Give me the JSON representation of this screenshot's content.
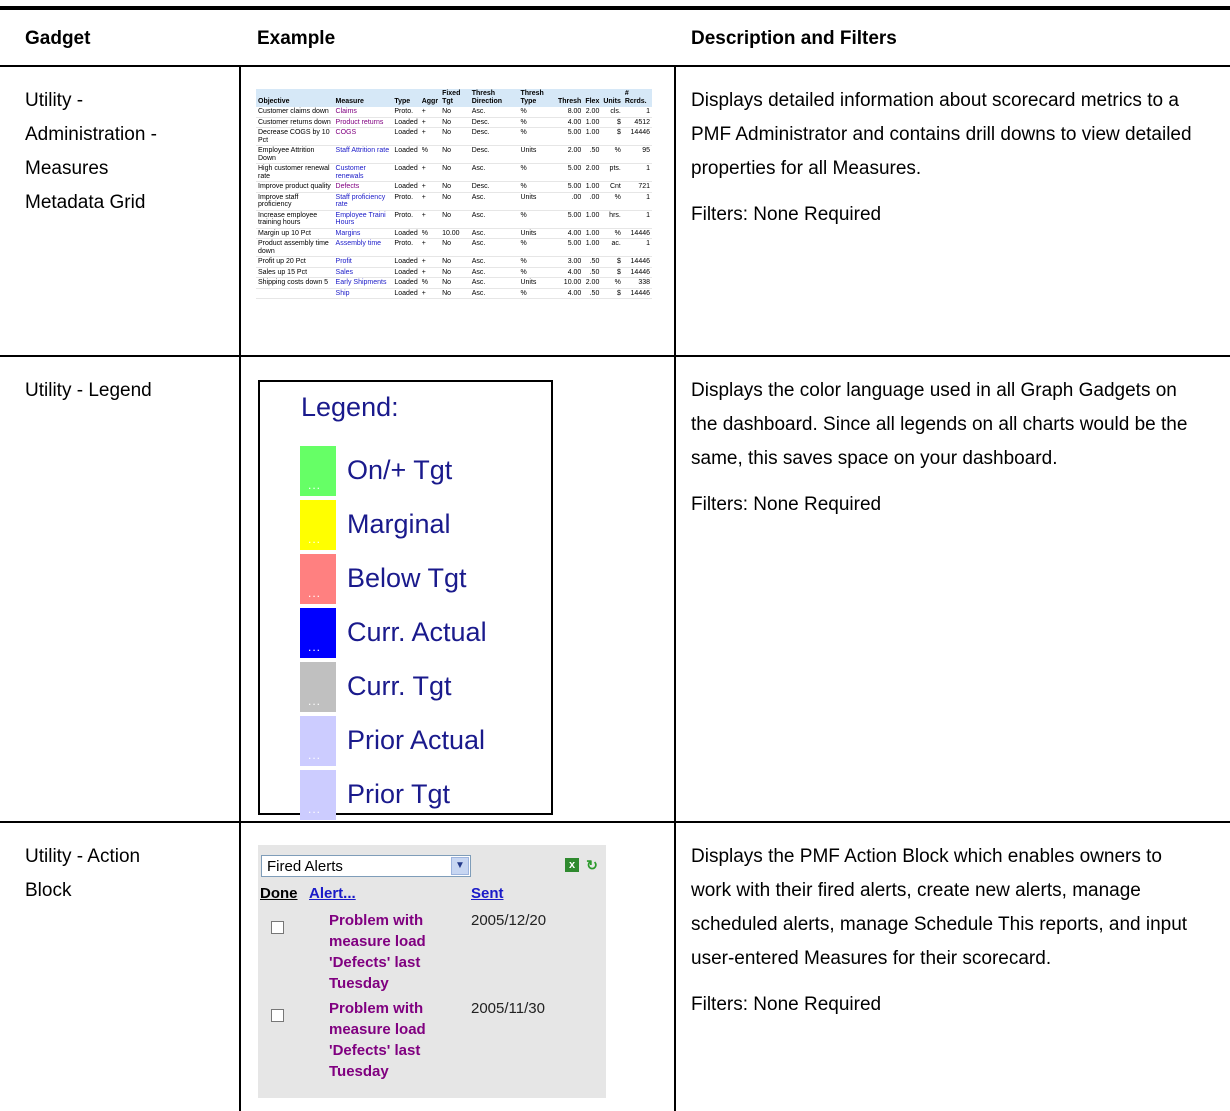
{
  "headers": {
    "gadget": "Gadget",
    "example": "Example",
    "description": "Description and Filters"
  },
  "rows": [
    {
      "gadget_lines": [
        "Utility -",
        "Administration -",
        "Measures",
        "Metadata Grid"
      ],
      "description": "Displays detailed information about scorecard metrics to a PMF Administrator and contains drill downs to view detailed properties for all Measures.",
      "filters": "Filters: None Required"
    },
    {
      "gadget_lines": [
        "Utility - Legend"
      ],
      "description": "Displays the color language used in all Graph Gadgets on the dashboard. Since all legends on all charts would be the same, this saves space on your dashboard.",
      "filters": "Filters: None Required"
    },
    {
      "gadget_lines": [
        "Utility - Action",
        "Block"
      ],
      "description": "Displays the PMF Action Block which enables owners to work with their fired alerts, create new alerts, manage scheduled alerts, manage Schedule This reports, and input user-entered Measures for their scorecard.",
      "filters": "Filters: None Required"
    }
  ],
  "metadata_grid": {
    "columns": [
      "Objective",
      "Measure",
      "Type",
      "Aggr",
      "Fixed Tgt",
      "Thresh Direction",
      "Thresh Type",
      "Thresh",
      "Flex",
      "Units",
      "# Rcrds."
    ],
    "rows": [
      [
        "Customer claims down",
        "Claims",
        "Proto.",
        "+",
        "No",
        "Asc.",
        "%",
        "8.00",
        "2.00",
        "cls.",
        "1"
      ],
      [
        "Customer returns down",
        "Product returns",
        "Loaded",
        "+",
        "No",
        "Desc.",
        "%",
        "4.00",
        "1.00",
        "$",
        "4512"
      ],
      [
        "Decrease COGS by 10 Pct",
        "COGS",
        "Loaded",
        "+",
        "No",
        "Desc.",
        "%",
        "5.00",
        "1.00",
        "$",
        "14446"
      ],
      [
        "Employee Attrition Down",
        "Staff Attrition rate",
        "Loaded",
        "%",
        "No",
        "Desc.",
        "Units",
        "2.00",
        ".50",
        "%",
        "95"
      ],
      [
        "High customer renewal rate",
        "Customer renewals",
        "Loaded",
        "+",
        "No",
        "Asc.",
        "%",
        "5.00",
        "2.00",
        "pts.",
        "1"
      ],
      [
        "Improve product quality",
        "Defects",
        "Loaded",
        "+",
        "No",
        "Desc.",
        "%",
        "5.00",
        "1.00",
        "Cnt",
        "721"
      ],
      [
        "Improve staff proficiency",
        "Staff proficiency rate",
        "Proto.",
        "+",
        "No",
        "Asc.",
        "Units",
        ".00",
        ".00",
        "%",
        "1"
      ],
      [
        "Increase employee training hours",
        "Employee Traini Hours",
        "Proto.",
        "+",
        "No",
        "Asc.",
        "%",
        "5.00",
        "1.00",
        "hrs.",
        "1"
      ],
      [
        "Margin up 10 Pct",
        "Margins",
        "Loaded",
        "%",
        "10.00",
        "Asc.",
        "Units",
        "4.00",
        "1.00",
        "%",
        "14446"
      ],
      [
        "Product assembly time down",
        "Assembly time",
        "Proto.",
        "+",
        "No",
        "Asc.",
        "%",
        "5.00",
        "1.00",
        "ac.",
        "1"
      ],
      [
        "Profit up 20 Pct",
        "Profit",
        "Loaded",
        "+",
        "No",
        "Asc.",
        "%",
        "3.00",
        ".50",
        "$",
        "14446"
      ],
      [
        "Sales up 15 Pct",
        "Sales",
        "Loaded",
        "+",
        "No",
        "Asc.",
        "%",
        "4.00",
        ".50",
        "$",
        "14446"
      ],
      [
        "Shipping costs down 5",
        "Early Shipments",
        "Loaded",
        "%",
        "No",
        "Asc.",
        "Units",
        "10.00",
        "2.00",
        "%",
        "338"
      ],
      [
        "",
        "Ship",
        "Loaded",
        "+",
        "No",
        "Asc.",
        "%",
        "4.00",
        ".50",
        "$",
        "14446"
      ]
    ]
  },
  "legend": {
    "title": "Legend:",
    "items": [
      {
        "label": "On/+ Tgt",
        "color": "#66ff66"
      },
      {
        "label": "Marginal",
        "color": "#ffff00"
      },
      {
        "label": "Below Tgt",
        "color": "#ff8080"
      },
      {
        "label": "Curr. Actual",
        "color": "#0000ff"
      },
      {
        "label": "Curr. Tgt",
        "color": "#c0c0c0"
      },
      {
        "label": "Prior Actual",
        "color": "#ccccff"
      },
      {
        "label": "Prior Tgt",
        "color": "#ccccff"
      }
    ],
    "swatch_text": "..."
  },
  "action_block": {
    "select_value": "Fired Alerts",
    "col_done": "Done",
    "col_alert": "Alert...",
    "col_sent": "Sent",
    "alerts": [
      {
        "text": "Problem with measure load 'Defects' last Tuesday",
        "date": "2005/12/20"
      },
      {
        "text": "Problem with measure load 'Defects' last Tuesday",
        "date": "2005/11/30"
      }
    ]
  }
}
